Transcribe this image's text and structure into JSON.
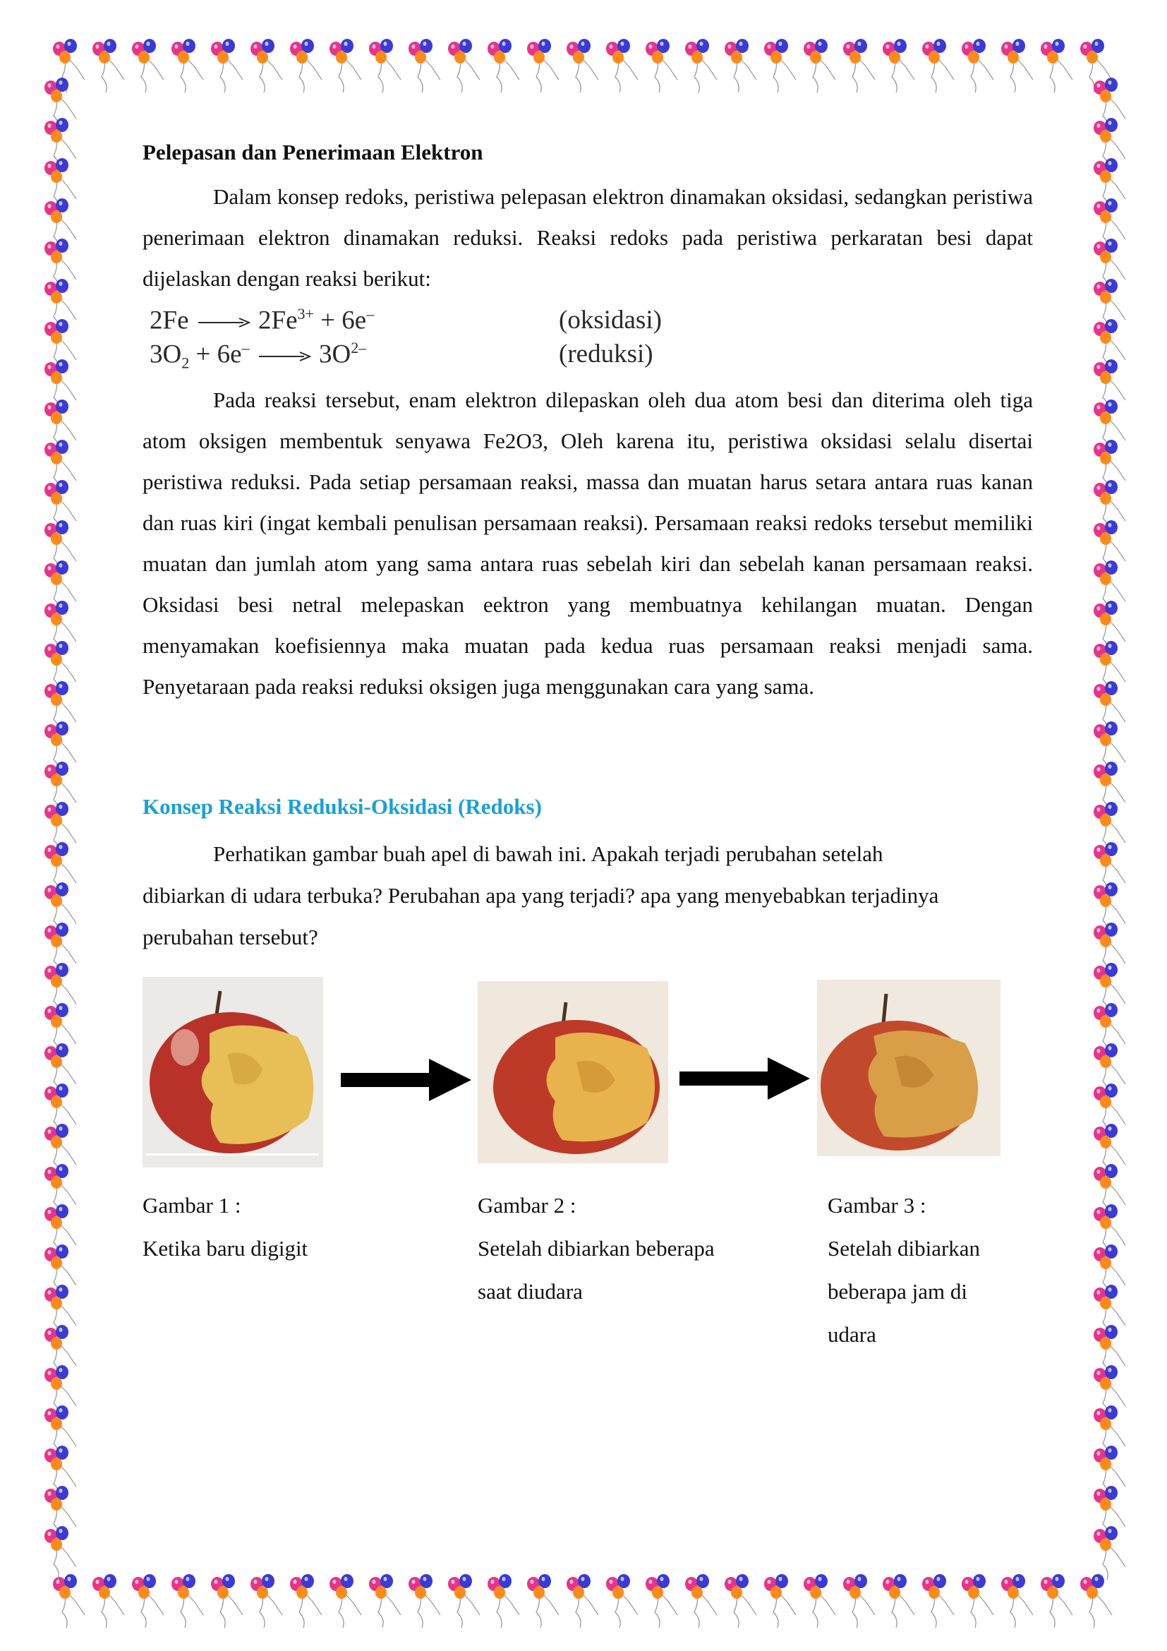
{
  "section1": {
    "heading": "Pelepasan dan Penerimaan Elektron",
    "para1": "Dalam konsep redoks, peristiwa pelepasan elektron dinamakan oksidasi, sedangkan peristiwa penerimaan elektron dinamakan reduksi. Reaksi redoks pada peristiwa perkaratan besi dapat dijelaskan dengan reaksi  berikut:",
    "equations": [
      {
        "reactant": "2Fe",
        "product_base": "2Fe",
        "product_sup": "3+",
        "extra": " + 6e",
        "extra_sup": "–",
        "label": "(oksidasi)"
      },
      {
        "reactant_base": "3O",
        "reactant_sub": "2",
        "reactant_rest": " + 6e",
        "reactant_sup": "–",
        "product_base": "3O",
        "product_sup": "2–",
        "label": "(reduksi)"
      }
    ],
    "para2": "Pada reaksi tersebut, enam elektron dilepaskan oleh dua atom besi dan diterima oleh tiga atom oksigen membentuk senyawa Fe2O3, Oleh karena itu, peristiwa oksidasi selalu disertai peristiwa reduksi. Pada setiap persamaan reaksi, massa dan muatan harus setara antara ruas kanan dan ruas kiri (ingat kembali penulisan persamaan reaksi). Persamaan reaksi redoks tersebut memiliki muatan dan jumlah atom yang sama antara ruas sebelah kiri dan sebelah kanan persamaan reaksi. Oksidasi besi netral melepaskan eektron yang membuatnya  kehilangan muatan. Dengan menyamakan koefisiennya maka muatan pada kedua ruas persamaan reaksi menjadi sama. Penyetaraan pada reaksi reduksi oksigen juga menggunakan cara yang sama."
  },
  "section2": {
    "heading": "Konsep Reaksi Reduksi-Oksidasi (Redoks)",
    "line1": "Perhatikan gambar buah apel di bawah ini. Apakah terjadi perubahan setelah",
    "line2": "dibiarkan di udara terbuka? Perubahan apa yang terjadi? apa yang menyebabkan terjadinya",
    "line3": "perubahan tersebut?"
  },
  "figures": [
    {
      "title": "Gambar 1 :",
      "lines": [
        "Ketika baru digigit"
      ]
    },
    {
      "title": "Gambar 2 :",
      "lines": [
        "Setelah dibiarkan beberapa",
        "saat diudara"
      ]
    },
    {
      "title": "Gambar 3 :",
      "lines": [
        "Setelah dibiarkan",
        "beberapa jam di",
        "udara"
      ]
    }
  ],
  "colors": {
    "heading_accent": "#1aa0d6",
    "balloon_colors": [
      "#e8338a",
      "#3a3ad8",
      "#ff8a1a",
      "#c43ee0"
    ]
  }
}
